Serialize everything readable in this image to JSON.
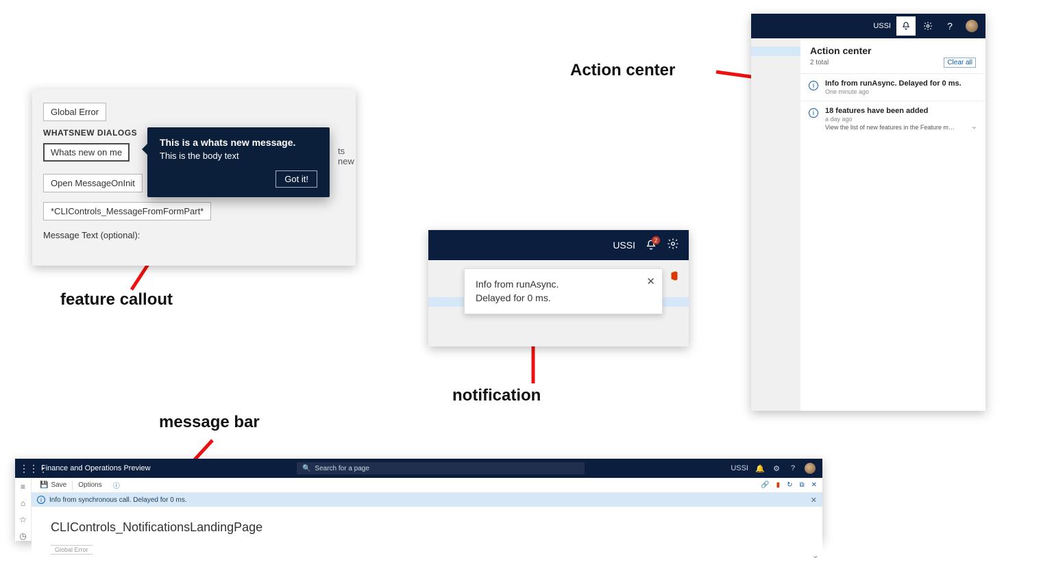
{
  "annotations": {
    "feature_callout": "feature callout",
    "notification": "notification",
    "message_bar": "message bar",
    "action_center": "Action center"
  },
  "callout_panel": {
    "btn_global_error": "Global Error",
    "section_label": "WHATSNEW DIALOGS",
    "btn_whats_new": "Whats new on me",
    "ghost_behind": "ts new",
    "btn_open_msg": "Open MessageOnInit",
    "btn_cli": "*CLIControls_MessageFromFormPart*",
    "optional_label": "Message Text (optional):",
    "popup": {
      "title": "This is a whats new message.",
      "body": "This is the body text",
      "gotit": "Got it!"
    }
  },
  "notif_panel": {
    "company": "USSI",
    "badge_count": "2",
    "toast_line1": "Info from runAsync.",
    "toast_line2": "Delayed for 0 ms."
  },
  "action_center": {
    "company": "USSI",
    "title": "Action center",
    "total": "2 total",
    "clear_all": "Clear all",
    "items": [
      {
        "title": "Info from runAsync. Delayed for 0 ms.",
        "sub": "One minute ago",
        "detail": ""
      },
      {
        "title": "18 features have been added",
        "sub": "a day ago",
        "detail": "View the list of new features in the Feature manageme..."
      }
    ]
  },
  "message_bar_panel": {
    "app_title": "Finance and Operations Preview",
    "search_placeholder": "Search for a page",
    "company": "USSI",
    "cmd_save": "Save",
    "cmd_options": "Options",
    "msg": "Info from synchronous call. Delayed for 0 ms.",
    "page_heading": "CLIControls_NotificationsLandingPage",
    "ghost": "Global Error"
  }
}
